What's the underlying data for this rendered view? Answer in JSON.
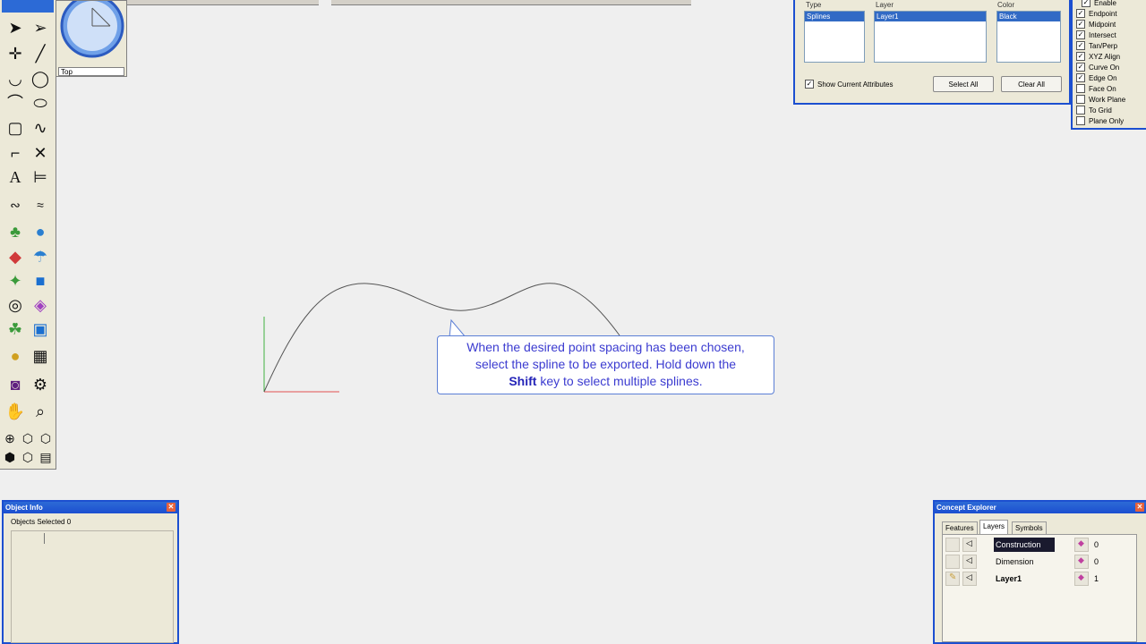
{
  "toolbar_icons": [
    "pointer-arrow-icon",
    "pointer-hollow-icon",
    "point-icon",
    "line-icon",
    "arc-icon",
    "circle-icon",
    "arc-tangent-icon",
    "ellipse-icon",
    "rectangle-icon",
    "spline-icon",
    "fillet-icon",
    "trim-icon",
    "text-icon",
    "dimension-icon",
    "curve-edit-icon",
    "curve-offset-icon",
    "extrude-icon",
    "sphere-icon",
    "sweep-icon",
    "revolve-icon",
    "boolean-icon",
    "box-icon",
    "shell-icon",
    "blend-icon",
    "surface-icon",
    "solid-icon",
    "light-icon",
    "grid-icon",
    "camera-icon",
    "animation-icon",
    "pan-hand-icon",
    "zoom-icon",
    "view-iso-icon",
    "view-cube-icon",
    "view-shaded-icon",
    "view-wire-icon",
    "view-fit-icon",
    "view-render-icon"
  ],
  "view": {
    "name": "Top"
  },
  "selection": {
    "type_header": "Type",
    "layer_header": "Layer",
    "color_header": "Color",
    "type_selected": "Splines",
    "layer_selected": "Layer1",
    "color_selected": "Black",
    "show_attributes_label": "Show Current Attributes",
    "show_attributes_checked": true,
    "select_all_label": "Select All",
    "clear_all_label": "Clear All"
  },
  "snap": {
    "items": [
      {
        "label": "Enable",
        "checked": true
      },
      {
        "label": "Endpoint",
        "checked": true
      },
      {
        "label": "Midpoint",
        "checked": true
      },
      {
        "label": "Intersect",
        "checked": true
      },
      {
        "label": "Tan/Perp",
        "checked": true
      },
      {
        "label": "XYZ Align",
        "checked": true
      },
      {
        "label": "Curve On",
        "checked": true
      },
      {
        "label": "Edge On",
        "checked": true
      },
      {
        "label": "Face On",
        "checked": false
      },
      {
        "label": "Work Plane",
        "checked": false
      },
      {
        "label": "To Grid",
        "checked": false
      },
      {
        "label": "Plane Only",
        "checked": false
      }
    ]
  },
  "callout": {
    "line1": "When the desired point spacing has been chosen,",
    "line2": "select the spline to be exported.  Hold down the",
    "keyword": "Shift",
    "line3_rest": " key to select multiple splines."
  },
  "object_info": {
    "title": "Object Info",
    "objects_selected": "Objects Selected 0"
  },
  "concept_explorer": {
    "title": "Concept Explorer",
    "tabs": [
      {
        "label": "Features"
      },
      {
        "label": "Layers"
      },
      {
        "label": "Symbols"
      }
    ],
    "active_tab": "Layers",
    "layers": [
      {
        "name": "Construction",
        "count": "0"
      },
      {
        "name": "Dimension",
        "count": "0"
      },
      {
        "name": "Layer1",
        "count": "1"
      }
    ]
  },
  "colors": {
    "accent": "#1c4fd0",
    "callout_text": "#3b3bd0",
    "axis_x": "#e05050",
    "axis_y": "#40b040",
    "spline": "#555555"
  }
}
